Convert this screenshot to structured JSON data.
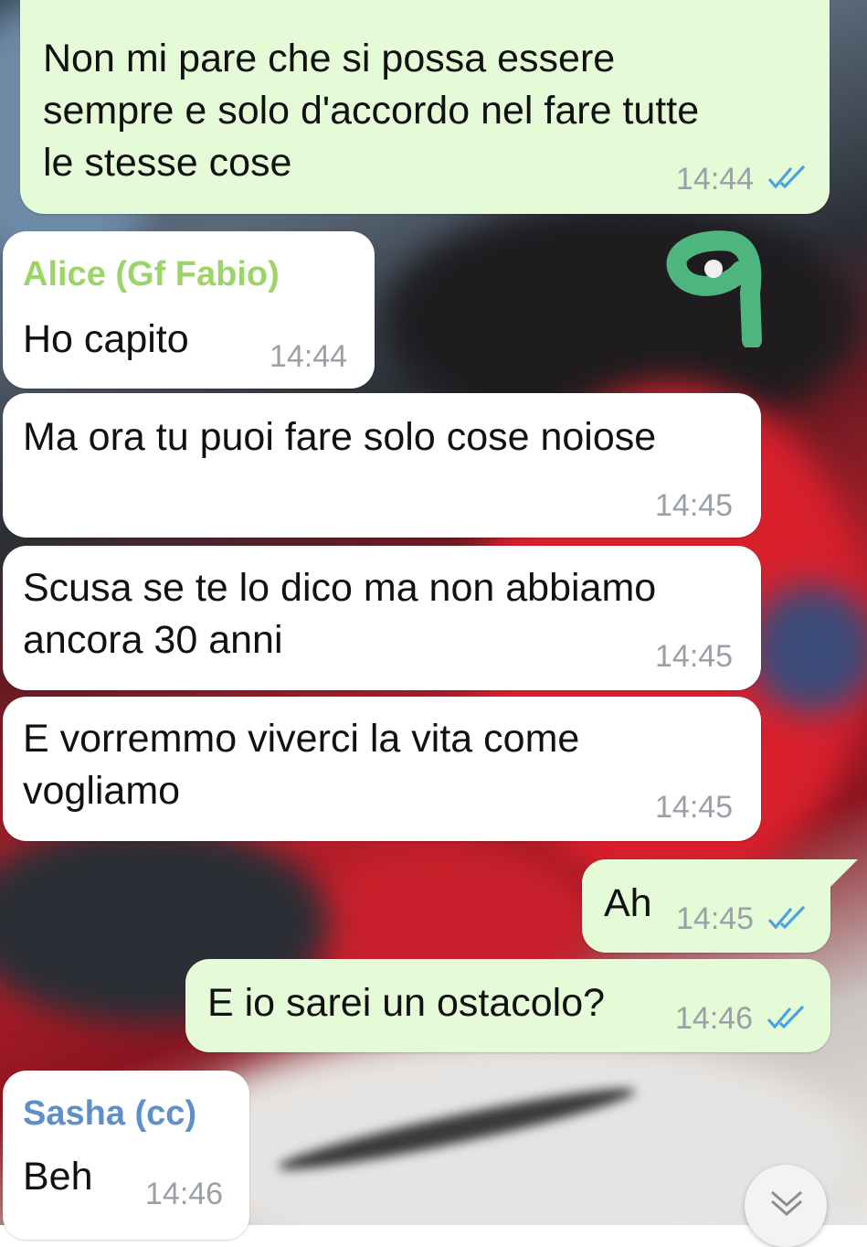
{
  "colors": {
    "outgoing_bubble": "#e5fad6",
    "incoming_bubble": "#ffffff",
    "read_ticks": "#4aa3df",
    "timestamp": "#9aa0a6",
    "sender_alice": "#9cd46a",
    "sender_sasha": "#5d8fc9",
    "sticker_annotation": "#4fb57e"
  },
  "annotation": {
    "text": "9"
  },
  "messages": [
    {
      "direction": "out",
      "text": "Non mi pare che si possa essere\nsempre e solo d'accordo nel fare tutte\nle stesse cose",
      "time": "14:44",
      "status": "read-ticks-icon"
    },
    {
      "direction": "in",
      "sender": "Alice (Gf Fabio)",
      "text": "Ho capito",
      "time": "14:44"
    },
    {
      "direction": "in",
      "text": "Ma ora tu puoi fare solo cose noiose",
      "time": "14:45"
    },
    {
      "direction": "in",
      "text": "Scusa se te lo dico ma non abbiamo\nancora 30 anni",
      "time": "14:45"
    },
    {
      "direction": "in",
      "text": "E vorremmo viverci la vita come\nvogliamo",
      "time": "14:45"
    },
    {
      "direction": "out",
      "text": "Ah",
      "time": "14:45",
      "status": "read-ticks-icon"
    },
    {
      "direction": "out",
      "text": "E io sarei un ostacolo?",
      "time": "14:46",
      "status": "read-ticks-icon"
    },
    {
      "direction": "in",
      "sender": "Sasha (cc)",
      "text": "Beh",
      "time": "14:46"
    }
  ],
  "scroll_button": {
    "icon": "chevron-down-icon"
  }
}
